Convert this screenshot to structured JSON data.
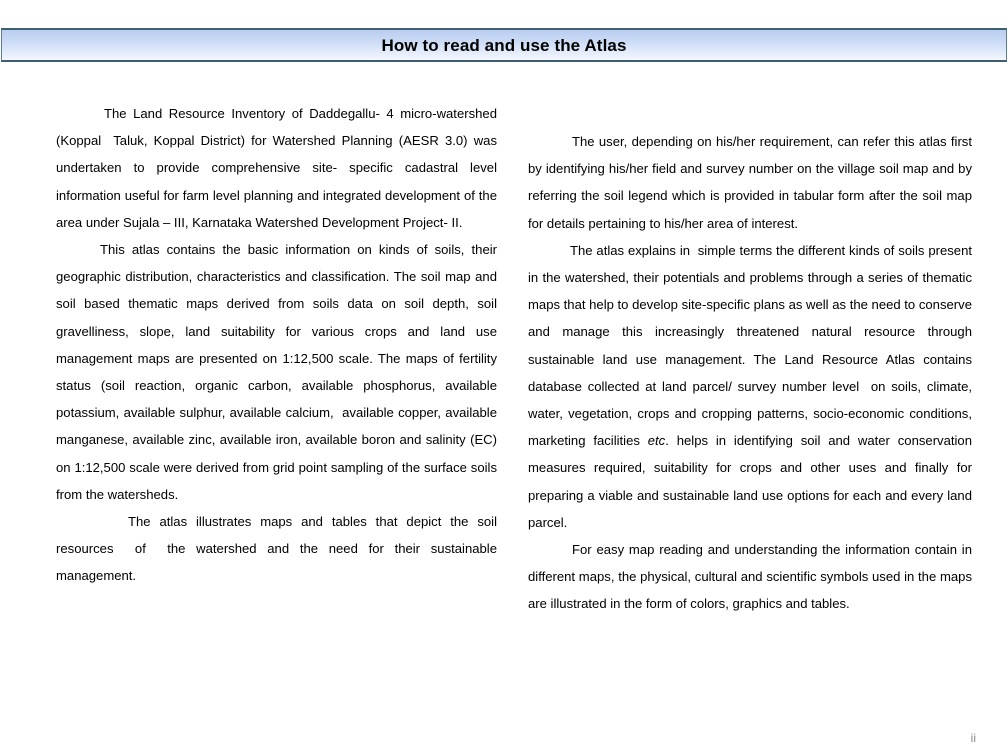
{
  "header": {
    "title": "How to read and use the Atlas",
    "border_color": "#3f5d72",
    "gradient_top": "#b9cdf0",
    "gradient_bottom": "#f3f7fe"
  },
  "left_column": {
    "paragraph_1": "The Land Resource Inventory of Daddegallu- 4 micro-watershed (Koppal  Taluk, Koppal District) for Watershed Planning (AESR 3.0) was undertaken to provide comprehensive site- specific cadastral level information useful for farm level planning and integrated development of the area under Sujala – III, Karnataka Watershed Development Project- II.",
    "paragraph_2_a": "This atlas contains the basic information on kinds of soils, their geographic distribution, characteristics and classification. The soil map and soil based thematic maps derived from soils data on soil depth, soil gravelliness, slope, land suitability for various crops and land use management maps are presented on 1:12,500 scale. The maps of fertility status (soil reaction, organic carbon, available phosphorus, available potassium, available sulphur, available calcium,  available copper, available manganese, available zinc, available iron, available boron and salinity (EC) on 1:12,500 scale were derived from grid point sampling of the surface soils from the watersheds.",
    "paragraph_3": "The atlas illustrates maps and tables that depict the soil resources  of  the watershed and the need for their sustainable management."
  },
  "right_column": {
    "paragraph_1": "The user, depending on his/her requirement, can refer this atlas first by identifying his/her field and survey number on the village soil map and by referring the soil legend which is provided in tabular form after the soil map for details pertaining to his/her area of interest.",
    "paragraph_2_before_italic": "The atlas explains in  simple terms the different kinds of soils present in the watershed, their potentials and problems through a series of thematic maps that help to develop site-specific plans as well as the need to conserve and manage this increasingly threatened natural resource through sustainable land use management. The Land Resource Atlas contains database collected at land parcel/ survey number level  on soils, climate, water, vegetation, crops and cropping patterns, socio-economic conditions, marketing facilities ",
    "paragraph_2_italic": "etc",
    "paragraph_2_after_italic": ". helps in identifying soil and water conservation measures required, suitability for crops and other uses and finally for preparing a viable and sustainable land use options for each and every land parcel.",
    "paragraph_3": "For easy map reading and understanding the information contain in different maps, the physical, cultural and scientific symbols used in the maps are illustrated in the form of colors, graphics and tables."
  },
  "footer": {
    "page_number": "ii"
  }
}
